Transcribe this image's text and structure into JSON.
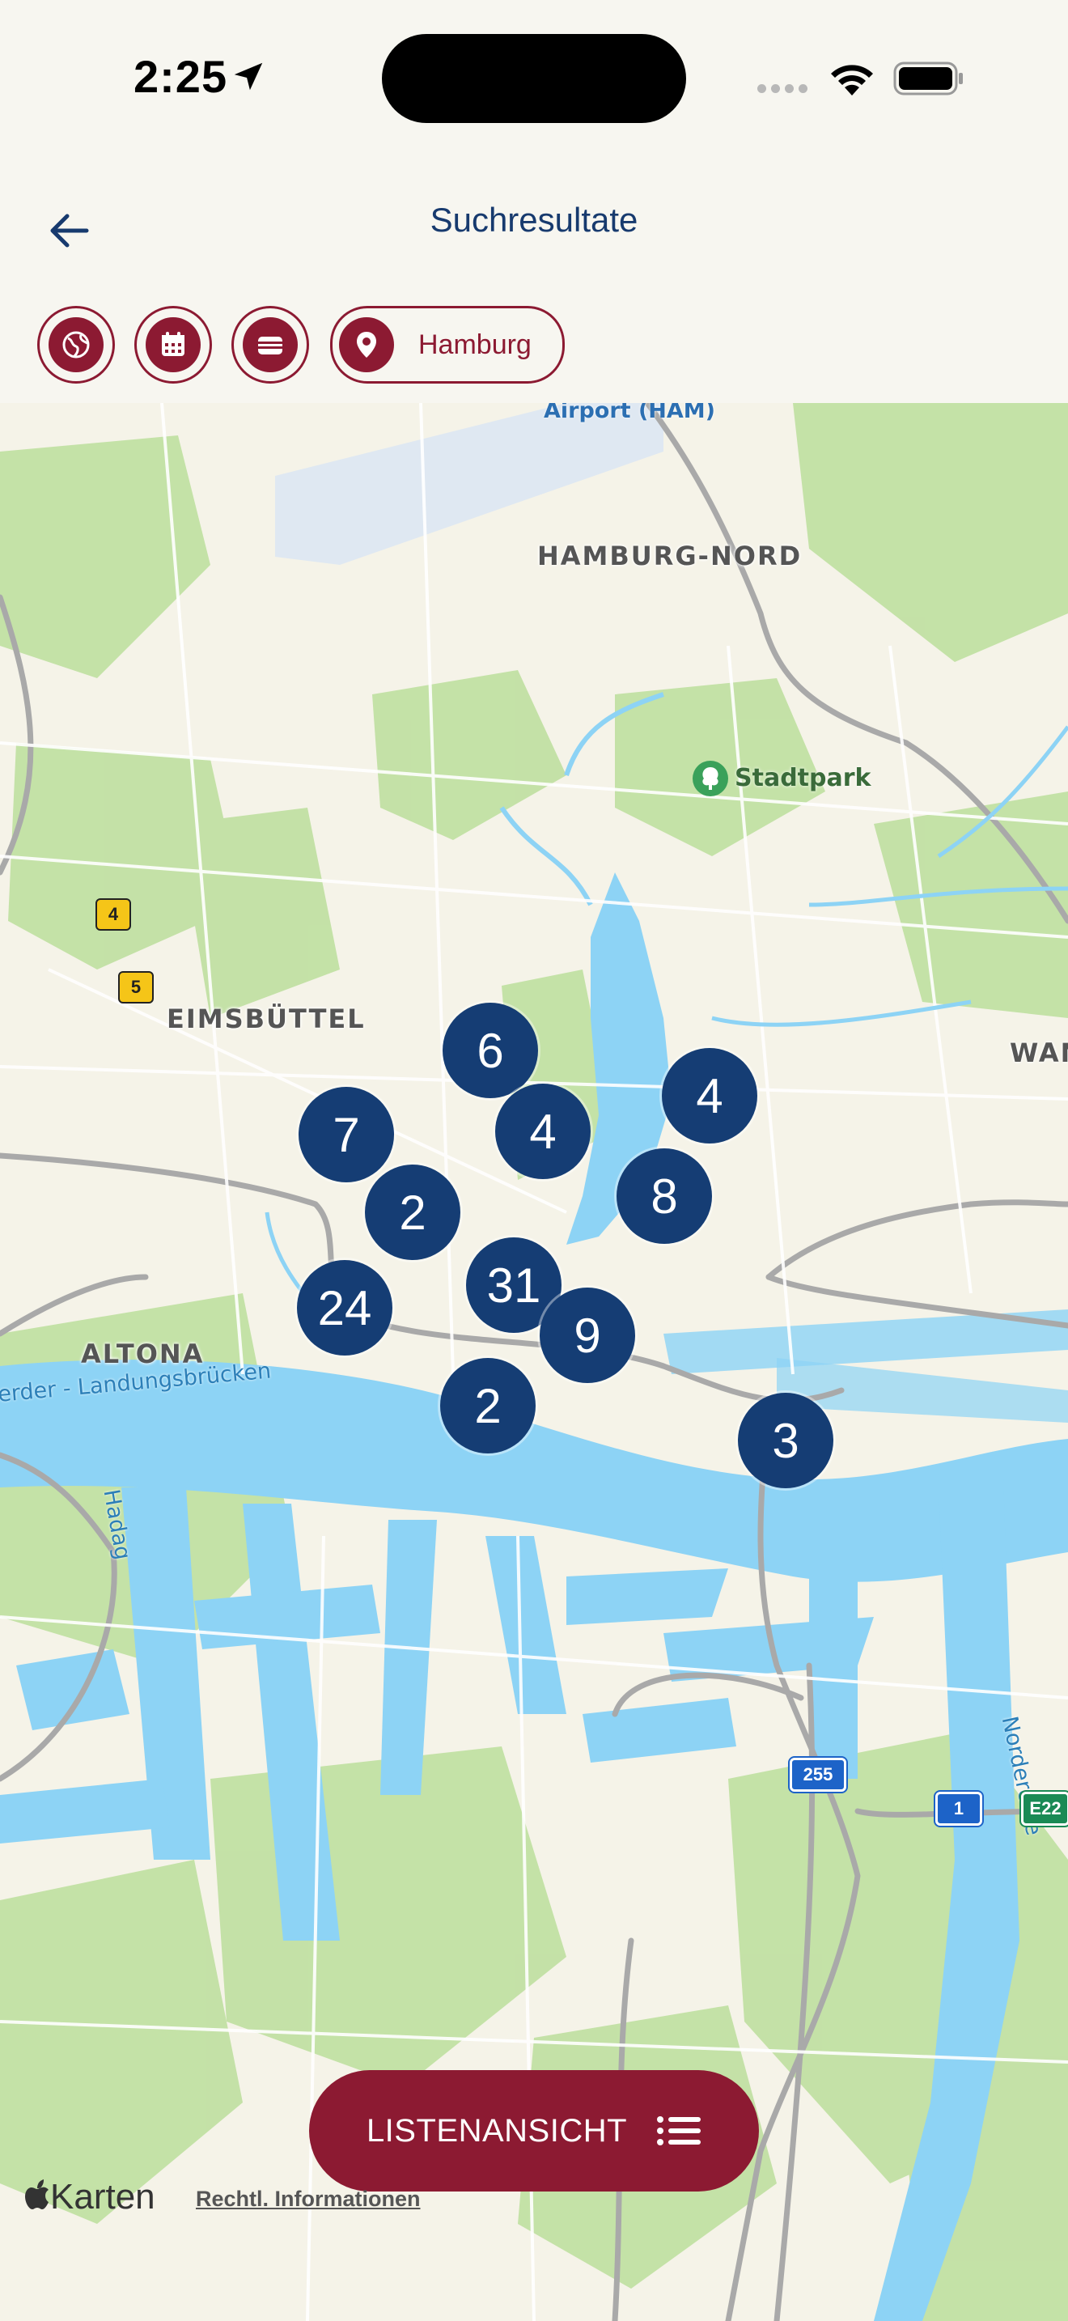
{
  "status_bar": {
    "time": "2:25"
  },
  "header": {
    "title": "Suchresultate"
  },
  "filters": {
    "globe_icon": "globe-icon",
    "calendar_icon": "calendar-icon",
    "wallet_icon": "wallet-icon",
    "location": "Hamburg"
  },
  "map": {
    "labels": {
      "airport": "Airport (HAM)",
      "hamburg_nord": "HAMBURG-NORD",
      "stadtpark": "Stadtpark",
      "eimsbuettel": "EIMSBÜTTEL",
      "altona": "ALTONA",
      "wan": "WAN",
      "landungsbruecken": "erder - Landungsbrücken",
      "hadag": "Hadag",
      "norderelbe": "Norderelbe"
    },
    "shields": {
      "a4": "4",
      "a5": "5",
      "b255": "255",
      "a1": "1",
      "e22": "E22"
    },
    "clusters": [
      "6",
      "7",
      "4",
      "2",
      "4",
      "8",
      "24",
      "31",
      "9",
      "2",
      "3"
    ],
    "attribution": "Karten",
    "legal": "Rechtl. Informationen"
  },
  "list_button": {
    "label": "LISTENANSICHT"
  },
  "colors": {
    "accent": "#8c1a32",
    "cluster": "#153d74",
    "title": "#173a6e"
  }
}
